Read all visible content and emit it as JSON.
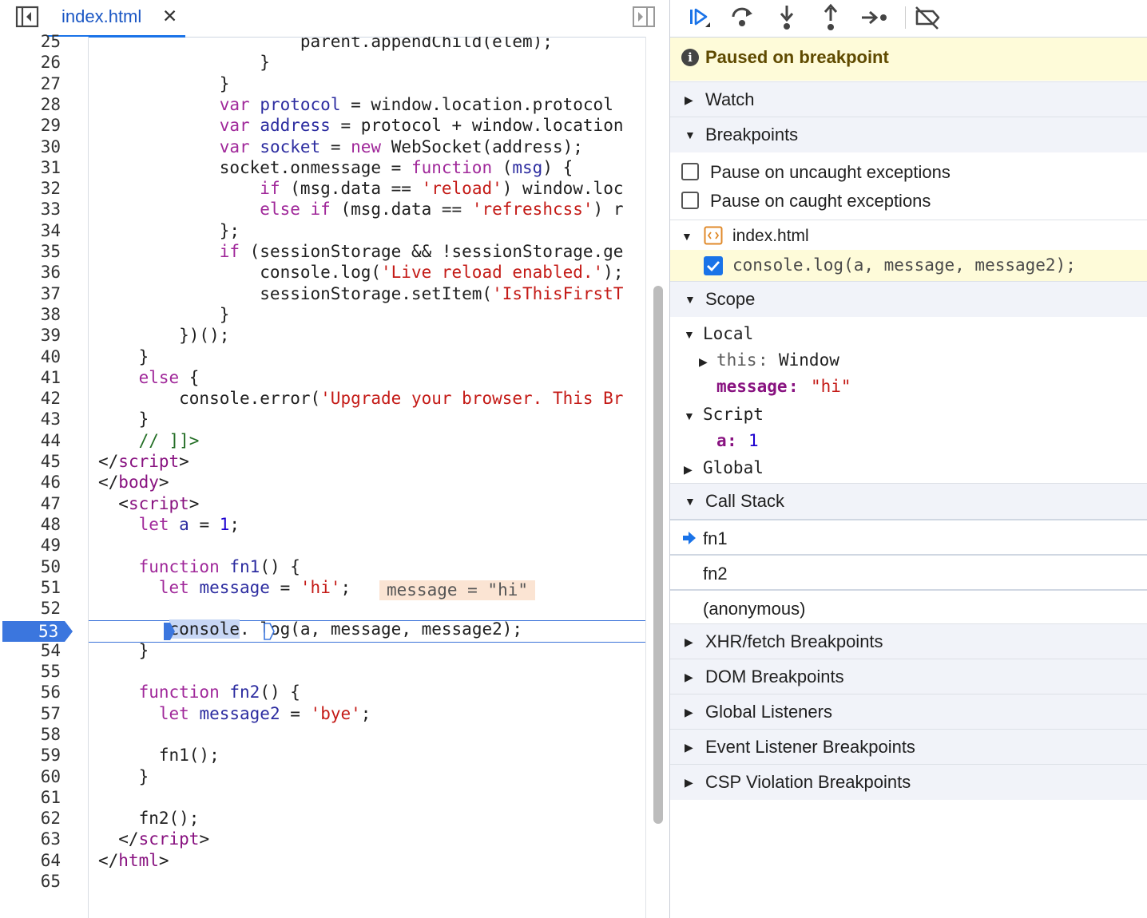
{
  "tab": {
    "file_name": "index.html",
    "close_glyph": "✕"
  },
  "code_lines": [
    {
      "n": "25",
      "t": "<span class=\"vr\" style=\"color:#202020\">                    parent.appendChild(elem);</span>"
    },
    {
      "n": "26",
      "t": "                }"
    },
    {
      "n": "27",
      "t": "            }"
    },
    {
      "n": "28",
      "t": "            <span class=\"kw\">var</span> <span class=\"vr\">protocol</span> = window.location.protocol"
    },
    {
      "n": "29",
      "t": "            <span class=\"kw\">var</span> <span class=\"vr\">address</span> = protocol + window.location"
    },
    {
      "n": "30",
      "t": "            <span class=\"kw\">var</span> <span class=\"vr\">socket</span> = <span class=\"kw\">new</span> WebSocket(address);"
    },
    {
      "n": "31",
      "t": "            socket.onmessage = <span class=\"kw\">function</span> (<span class=\"vr\">msg</span>) {"
    },
    {
      "n": "32",
      "t": "                <span class=\"kw\">if</span> (msg.data == <span class=\"st\">'reload'</span>) window.loc"
    },
    {
      "n": "33",
      "t": "                <span class=\"kw\">else if</span> (msg.data == <span class=\"st\">'refreshcss'</span>) r"
    },
    {
      "n": "34",
      "t": "            };"
    },
    {
      "n": "35",
      "t": "            <span class=\"kw\">if</span> (sessionStorage &amp;&amp; !sessionStorage.ge"
    },
    {
      "n": "36",
      "t": "                console.log(<span class=\"st\">'Live reload enabled.'</span>);"
    },
    {
      "n": "37",
      "t": "                sessionStorage.setItem(<span class=\"st\">'IsThisFirstT</span>"
    },
    {
      "n": "38",
      "t": "            }"
    },
    {
      "n": "39",
      "t": "        })();"
    },
    {
      "n": "40",
      "t": "    }"
    },
    {
      "n": "41",
      "t": "    <span class=\"kw\">else</span> {"
    },
    {
      "n": "42",
      "t": "        console.error(<span class=\"st\">'Upgrade your browser. This Br</span>"
    },
    {
      "n": "43",
      "t": "    }"
    },
    {
      "n": "44",
      "t": "    <span class=\"cm\">// ]]&gt;</span>"
    },
    {
      "n": "45",
      "t": "&lt;/<span class=\"tg\">script</span>&gt;"
    },
    {
      "n": "46",
      "t": "&lt;/<span class=\"tg\">body</span>&gt;"
    },
    {
      "n": "47",
      "t": "  &lt;<span class=\"tg\">script</span>&gt;"
    },
    {
      "n": "48",
      "t": "    <span class=\"kw\">let</span> <span class=\"vr\">a</span> = <span class=\"nm\">1</span>;"
    },
    {
      "n": "49",
      "t": ""
    },
    {
      "n": "50",
      "t": "    <span class=\"kw\">function</span> <span class=\"vr\">fn1</span>() {"
    },
    {
      "n": "51",
      "t": "      <span class=\"kw\">let</span> <span class=\"vr\">message</span> = <span class=\"st\">'hi'</span>;"
    },
    {
      "n": "52",
      "t": ""
    },
    {
      "n": "53",
      "t": "       <span style=\"background:#c8d7f5\">console</span>. log(a, message, message2);"
    },
    {
      "n": "54",
      "t": "    }"
    },
    {
      "n": "55",
      "t": ""
    },
    {
      "n": "56",
      "t": "    <span class=\"kw\">function</span> <span class=\"vr\">fn2</span>() {"
    },
    {
      "n": "57",
      "t": "      <span class=\"kw\">let</span> <span class=\"vr\">message2</span> = <span class=\"st\">'bye'</span>;"
    },
    {
      "n": "58",
      "t": ""
    },
    {
      "n": "59",
      "t": "      fn1();"
    },
    {
      "n": "60",
      "t": "    }"
    },
    {
      "n": "61",
      "t": ""
    },
    {
      "n": "62",
      "t": "    fn2();"
    },
    {
      "n": "63",
      "t": "  &lt;/<span class=\"tg\">script</span>&gt;"
    },
    {
      "n": "64",
      "t": "&lt;/<span class=\"tg\">html</span>&gt;"
    },
    {
      "n": "65",
      "t": ""
    }
  ],
  "inline_value": "message = \"hi\"",
  "execution_line": "53",
  "sidebar": {
    "paused_text": "Paused on breakpoint",
    "sections": {
      "watch": "Watch",
      "breakpoints": "Breakpoints",
      "scope": "Scope",
      "call_stack": "Call Stack",
      "xhr": "XHR/fetch Breakpoints",
      "dom": "DOM Breakpoints",
      "global_listeners": "Global Listeners",
      "event_listener": "Event Listener Breakpoints",
      "csp": "CSP Violation Breakpoints"
    },
    "pause_uncaught": "Pause on uncaught exceptions",
    "pause_caught": "Pause on caught exceptions",
    "bp_file": "index.html",
    "bp_code": "console.log(a, message, message2);",
    "scope": {
      "local": "Local",
      "this_key": "this",
      "this_val": "Window",
      "message_key": "message",
      "message_val": "\"hi\"",
      "script": "Script",
      "a_key": "a",
      "a_val": "1",
      "global": "Global"
    },
    "call_stack": [
      "fn1",
      "fn2",
      "(anonymous)"
    ]
  },
  "colors": {
    "accent": "#1a73e8",
    "paused_bg": "#fefbd9",
    "section_bg": "#f1f3f9"
  },
  "icons": [
    "sidebar-toggle-icon",
    "close-icon",
    "resume-icon",
    "step-over-icon",
    "step-into-icon",
    "step-out-icon",
    "step-icon",
    "deactivate-breakpoints-icon",
    "info-icon",
    "file-icon",
    "checkbox-icon",
    "execution-arrow-icon"
  ]
}
